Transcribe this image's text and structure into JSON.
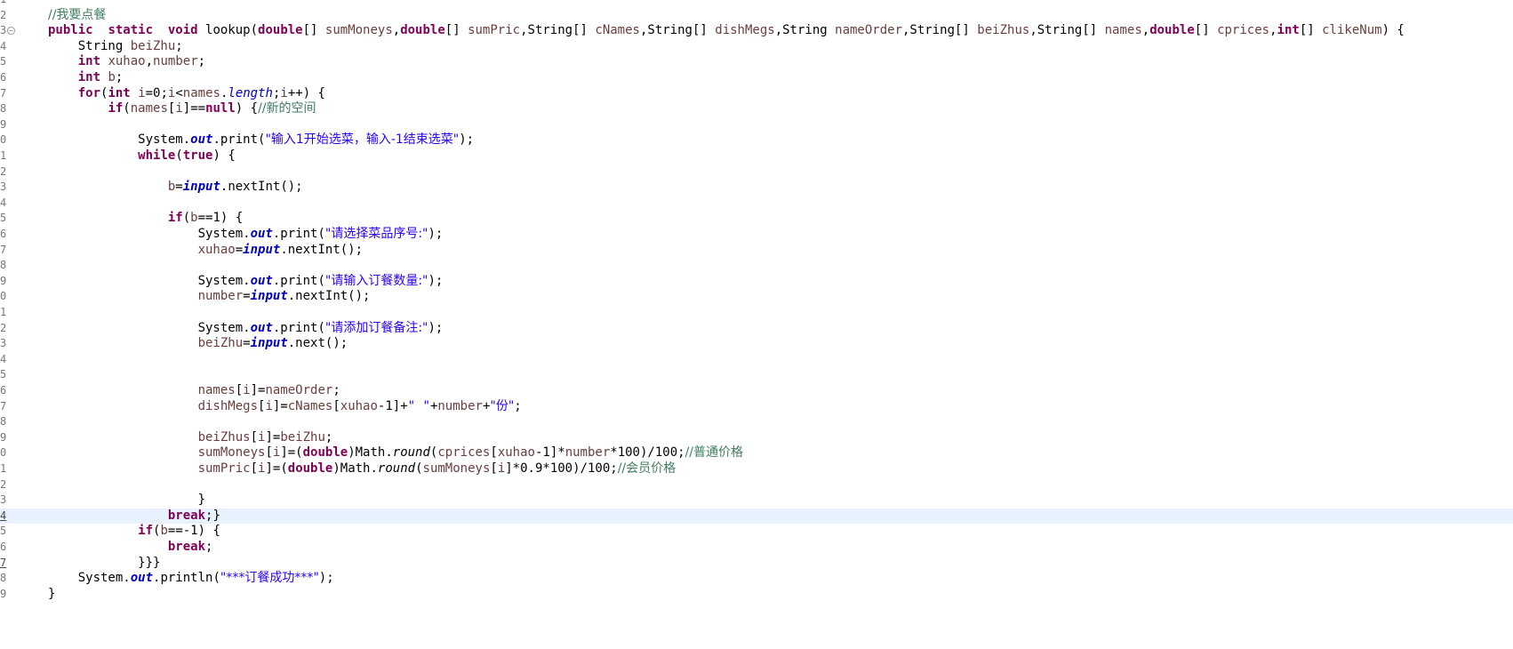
{
  "editor": {
    "title": "Java source editor",
    "lines": [
      {
        "num": "1",
        "tokens": []
      },
      {
        "num": "2",
        "tokens": [
          [
            "cmt",
            "//我要点餐"
          ]
        ]
      },
      {
        "num": "3",
        "fold": "⊖",
        "tokens": [
          [
            "kw",
            "public"
          ],
          [
            "",
            "  "
          ],
          [
            "kw",
            "static"
          ],
          [
            "",
            "  "
          ],
          [
            "kw",
            "void"
          ],
          [
            "",
            " lookup("
          ],
          [
            "kw",
            "double"
          ],
          [
            "",
            "[] "
          ],
          [
            "var",
            "sumMoneys"
          ],
          [
            "",
            ","
          ],
          [
            "kw",
            "double"
          ],
          [
            "",
            "[] "
          ],
          [
            "var",
            "sumPric"
          ],
          [
            "",
            ",String[] "
          ],
          [
            "var",
            "cNames"
          ],
          [
            "",
            ",String[] "
          ],
          [
            "var",
            "dishMegs"
          ],
          [
            "",
            ",String "
          ],
          [
            "var",
            "nameOrder"
          ],
          [
            "",
            ",String[] "
          ],
          [
            "var",
            "beiZhus"
          ],
          [
            "",
            ",String[] "
          ],
          [
            "var",
            "names"
          ],
          [
            "",
            ","
          ],
          [
            "kw",
            "double"
          ],
          [
            "",
            "[] "
          ],
          [
            "var",
            "cprices"
          ],
          [
            "",
            ","
          ],
          [
            "kw",
            "int"
          ],
          [
            "",
            "[] "
          ],
          [
            "var",
            "clikeNum"
          ],
          [
            "",
            ") {"
          ]
        ]
      },
      {
        "num": "4",
        "tokens": [
          [
            "",
            "    String "
          ],
          [
            "var",
            "beiZhu"
          ],
          [
            "",
            ";"
          ]
        ]
      },
      {
        "num": "5",
        "tokens": [
          [
            "",
            "    "
          ],
          [
            "kw",
            "int"
          ],
          [
            "",
            " "
          ],
          [
            "var",
            "xuhao"
          ],
          [
            "",
            ","
          ],
          [
            "var",
            "number"
          ],
          [
            "",
            ";"
          ]
        ]
      },
      {
        "num": "6",
        "tokens": [
          [
            "",
            "    "
          ],
          [
            "kw",
            "int"
          ],
          [
            "",
            " "
          ],
          [
            "var",
            "b"
          ],
          [
            "",
            ";"
          ]
        ]
      },
      {
        "num": "7",
        "tokens": [
          [
            "",
            "    "
          ],
          [
            "kw",
            "for"
          ],
          [
            "",
            "("
          ],
          [
            "kw",
            "int"
          ],
          [
            "",
            " "
          ],
          [
            "var",
            "i"
          ],
          [
            "",
            "=0;"
          ],
          [
            "var",
            "i"
          ],
          [
            "",
            "<"
          ],
          [
            "var",
            "names"
          ],
          [
            "",
            "."
          ],
          [
            "sfld",
            "length"
          ],
          [
            "",
            ";"
          ],
          [
            "var",
            "i"
          ],
          [
            "",
            "++) {"
          ]
        ]
      },
      {
        "num": "8",
        "tokens": [
          [
            "",
            "        "
          ],
          [
            "kw",
            "if"
          ],
          [
            "",
            "("
          ],
          [
            "var",
            "names"
          ],
          [
            "",
            "["
          ],
          [
            "var",
            "i"
          ],
          [
            "",
            "]=="
          ],
          [
            "kw",
            "null"
          ],
          [
            "",
            ") {"
          ],
          [
            "cmt",
            "//新的空间"
          ]
        ]
      },
      {
        "num": "9",
        "tokens": []
      },
      {
        "num": "0",
        "tokens": [
          [
            "",
            "            System."
          ],
          [
            "fld",
            "out"
          ],
          [
            "",
            ".print("
          ],
          [
            "str",
            "\"输入1开始选菜，输入-1结束选菜\""
          ],
          [
            "",
            ");"
          ]
        ]
      },
      {
        "num": "1",
        "tokens": [
          [
            "",
            "            "
          ],
          [
            "kw",
            "while"
          ],
          [
            "",
            "("
          ],
          [
            "kw",
            "true"
          ],
          [
            "",
            ") {"
          ]
        ]
      },
      {
        "num": "2",
        "tokens": []
      },
      {
        "num": "3",
        "tokens": [
          [
            "",
            "                "
          ],
          [
            "var",
            "b"
          ],
          [
            "",
            "="
          ],
          [
            "fld",
            "input"
          ],
          [
            "",
            ".nextInt();"
          ]
        ]
      },
      {
        "num": "4",
        "tokens": []
      },
      {
        "num": "5",
        "tokens": [
          [
            "",
            "                "
          ],
          [
            "kw",
            "if"
          ],
          [
            "",
            "("
          ],
          [
            "var",
            "b"
          ],
          [
            "",
            "==1) {"
          ]
        ]
      },
      {
        "num": "6",
        "tokens": [
          [
            "",
            "                    System."
          ],
          [
            "fld",
            "out"
          ],
          [
            "",
            ".print("
          ],
          [
            "str",
            "\"请选择菜品序号:\""
          ],
          [
            "",
            ");"
          ]
        ]
      },
      {
        "num": "7",
        "tokens": [
          [
            "",
            "                    "
          ],
          [
            "var",
            "xuhao"
          ],
          [
            "",
            "="
          ],
          [
            "fld",
            "input"
          ],
          [
            "",
            ".nextInt();"
          ]
        ]
      },
      {
        "num": "8",
        "tokens": []
      },
      {
        "num": "9",
        "tokens": [
          [
            "",
            "                    System."
          ],
          [
            "fld",
            "out"
          ],
          [
            "",
            ".print("
          ],
          [
            "str",
            "\"请输入订餐数量:\""
          ],
          [
            "",
            ");"
          ]
        ]
      },
      {
        "num": "0",
        "tokens": [
          [
            "",
            "                    "
          ],
          [
            "var",
            "number"
          ],
          [
            "",
            "="
          ],
          [
            "fld",
            "input"
          ],
          [
            "",
            ".nextInt();"
          ]
        ]
      },
      {
        "num": "1",
        "tokens": []
      },
      {
        "num": "2",
        "tokens": [
          [
            "",
            "                    System."
          ],
          [
            "fld",
            "out"
          ],
          [
            "",
            ".print("
          ],
          [
            "str",
            "\"请添加订餐备注:\""
          ],
          [
            "",
            ");"
          ]
        ]
      },
      {
        "num": "3",
        "tokens": [
          [
            "",
            "                    "
          ],
          [
            "var",
            "beiZhu"
          ],
          [
            "",
            "="
          ],
          [
            "fld",
            "input"
          ],
          [
            "",
            ".next();"
          ]
        ]
      },
      {
        "num": "4",
        "tokens": []
      },
      {
        "num": "5",
        "tokens": []
      },
      {
        "num": "6",
        "tokens": [
          [
            "",
            "                    "
          ],
          [
            "var",
            "names"
          ],
          [
            "",
            "["
          ],
          [
            "var",
            "i"
          ],
          [
            "",
            "]="
          ],
          [
            "var",
            "nameOrder"
          ],
          [
            "",
            ";"
          ]
        ]
      },
      {
        "num": "7",
        "tokens": [
          [
            "",
            "                    "
          ],
          [
            "var",
            "dishMegs"
          ],
          [
            "",
            "["
          ],
          [
            "var",
            "i"
          ],
          [
            "",
            "]="
          ],
          [
            "var",
            "cNames"
          ],
          [
            "",
            "["
          ],
          [
            "var",
            "xuhao"
          ],
          [
            "",
            "-1]+"
          ],
          [
            "str",
            "\" \""
          ],
          [
            "",
            "+"
          ],
          [
            "var",
            "number"
          ],
          [
            "",
            "+"
          ],
          [
            "str",
            "\"份\""
          ],
          [
            "",
            ";"
          ]
        ]
      },
      {
        "num": "8",
        "tokens": []
      },
      {
        "num": "9",
        "tokens": [
          [
            "",
            "                    "
          ],
          [
            "var",
            "beiZhus"
          ],
          [
            "",
            "["
          ],
          [
            "var",
            "i"
          ],
          [
            "",
            "]="
          ],
          [
            "var",
            "beiZhu"
          ],
          [
            "",
            ";"
          ]
        ]
      },
      {
        "num": "0",
        "tokens": [
          [
            "",
            "                    "
          ],
          [
            "var",
            "sumMoneys"
          ],
          [
            "",
            "["
          ],
          [
            "var",
            "i"
          ],
          [
            "",
            "]=("
          ],
          [
            "kw",
            "double"
          ],
          [
            "",
            ")Math."
          ],
          [
            "mth",
            "round"
          ],
          [
            "",
            "("
          ],
          [
            "var",
            "cprices"
          ],
          [
            "",
            "["
          ],
          [
            "var",
            "xuhao"
          ],
          [
            "",
            "-1]*"
          ],
          [
            "var",
            "number"
          ],
          [
            "",
            "*100)/100;"
          ],
          [
            "cmt",
            "//普通价格"
          ]
        ]
      },
      {
        "num": "1",
        "tokens": [
          [
            "",
            "                    "
          ],
          [
            "var",
            "sumPric"
          ],
          [
            "",
            "["
          ],
          [
            "var",
            "i"
          ],
          [
            "",
            "]=("
          ],
          [
            "kw",
            "double"
          ],
          [
            "",
            ")Math."
          ],
          [
            "mth",
            "round"
          ],
          [
            "",
            "("
          ],
          [
            "var",
            "sumMoneys"
          ],
          [
            "",
            "["
          ],
          [
            "var",
            "i"
          ],
          [
            "",
            "]*0.9*100)/100;"
          ],
          [
            "cmt",
            "//会员价格"
          ]
        ]
      },
      {
        "num": "2",
        "tokens": []
      },
      {
        "num": "3",
        "tokens": [
          [
            "",
            "                    }"
          ]
        ]
      },
      {
        "num": "4",
        "current": true,
        "hl": true,
        "tokens": [
          [
            "",
            "                "
          ],
          [
            "kw",
            "break"
          ],
          [
            "",
            ";}"
          ]
        ]
      },
      {
        "num": "5",
        "tokens": [
          [
            "",
            "            "
          ],
          [
            "kw",
            "if"
          ],
          [
            "",
            "("
          ],
          [
            "var",
            "b"
          ],
          [
            "",
            "==-1) {"
          ]
        ]
      },
      {
        "num": "6",
        "tokens": [
          [
            "",
            "                "
          ],
          [
            "kw",
            "break"
          ],
          [
            "",
            ";"
          ]
        ]
      },
      {
        "num": "7",
        "hl": true,
        "tokens": [
          [
            "",
            "            }}}"
          ]
        ]
      },
      {
        "num": "8",
        "tokens": [
          [
            "",
            "    System."
          ],
          [
            "fld",
            "out"
          ],
          [
            "",
            ".println("
          ],
          [
            "str",
            "\"***订餐成功***\""
          ],
          [
            "",
            ");"
          ]
        ]
      },
      {
        "num": "9",
        "tokens": [
          [
            "",
            "}"
          ]
        ]
      }
    ]
  }
}
